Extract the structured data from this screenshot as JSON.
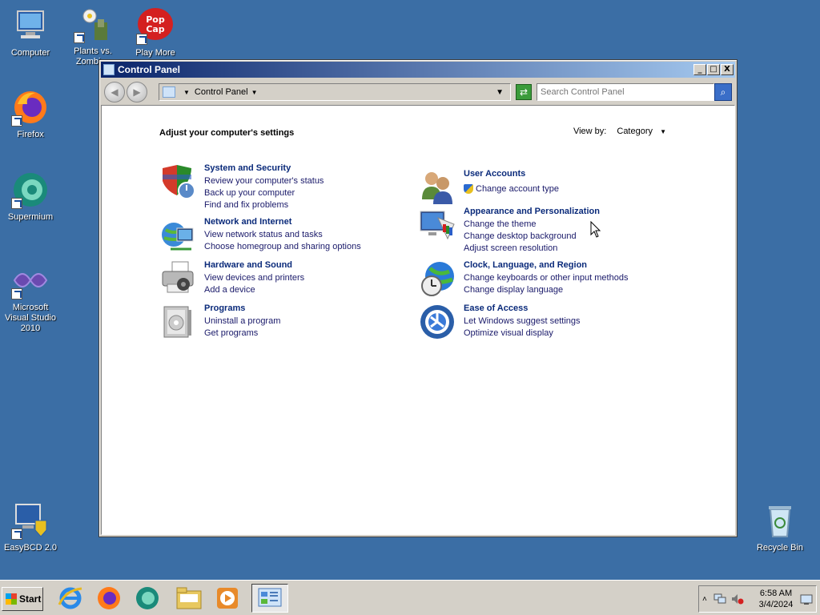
{
  "desktop": {
    "icons": [
      {
        "label": "Computer"
      },
      {
        "label": "Plants vs. Zombies"
      },
      {
        "label": "Play More"
      },
      {
        "label": "Firefox"
      },
      {
        "label": "Supermium"
      },
      {
        "label": "Microsoft Visual Studio 2010"
      },
      {
        "label": "EasyBCD 2.0"
      },
      {
        "label": "Recycle Bin"
      }
    ]
  },
  "window": {
    "title": "Control Panel",
    "buttons": {
      "minimize": "_",
      "maximize": "□",
      "close": "X"
    },
    "address": "Control Panel",
    "search_placeholder": "Search Control Panel"
  },
  "content": {
    "heading": "Adjust your computer's settings",
    "view_by_label": "View by:",
    "view_by_value": "Category",
    "categories": [
      {
        "title": "System and Security",
        "icon": "shield-icon",
        "links": [
          "Review your computer's status",
          "Back up your computer",
          "Find and fix problems"
        ]
      },
      {
        "title": "Network and Internet",
        "icon": "network-globe-icon",
        "links": [
          "View network status and tasks",
          "Choose homegroup and sharing options"
        ]
      },
      {
        "title": "Hardware and Sound",
        "icon": "printer-icon",
        "links": [
          "View devices and printers",
          "Add a device"
        ]
      },
      {
        "title": "Programs",
        "icon": "programs-icon",
        "links": [
          "Uninstall a program",
          "Get programs"
        ]
      },
      {
        "title": "User Accounts",
        "icon": "users-icon",
        "links": [
          "Change account type"
        ]
      },
      {
        "title": "Appearance and Personalization",
        "icon": "monitor-paint-icon",
        "links": [
          "Change the theme",
          "Change desktop background",
          "Adjust screen resolution"
        ]
      },
      {
        "title": "Clock, Language, and Region",
        "icon": "globe-clock-icon",
        "links": [
          "Change keyboards or other input methods",
          "Change display language"
        ]
      },
      {
        "title": "Ease of Access",
        "icon": "ease-of-access-icon",
        "links": [
          "Let Windows suggest settings",
          "Optimize visual display"
        ]
      }
    ]
  },
  "taskbar": {
    "start_label": "Start",
    "apps": [
      "internet-explorer-icon",
      "firefox-icon",
      "supermium-icon",
      "file-explorer-icon",
      "media-player-icon",
      "control-panel-icon"
    ],
    "clock_time": "6:58 AM",
    "clock_date": "3/4/2024"
  },
  "colors": {
    "desktop": "#3b6ea5",
    "titlebar_start": "#0a246a",
    "titlebar_end": "#a6caf0",
    "link": "#0a2a7a"
  }
}
